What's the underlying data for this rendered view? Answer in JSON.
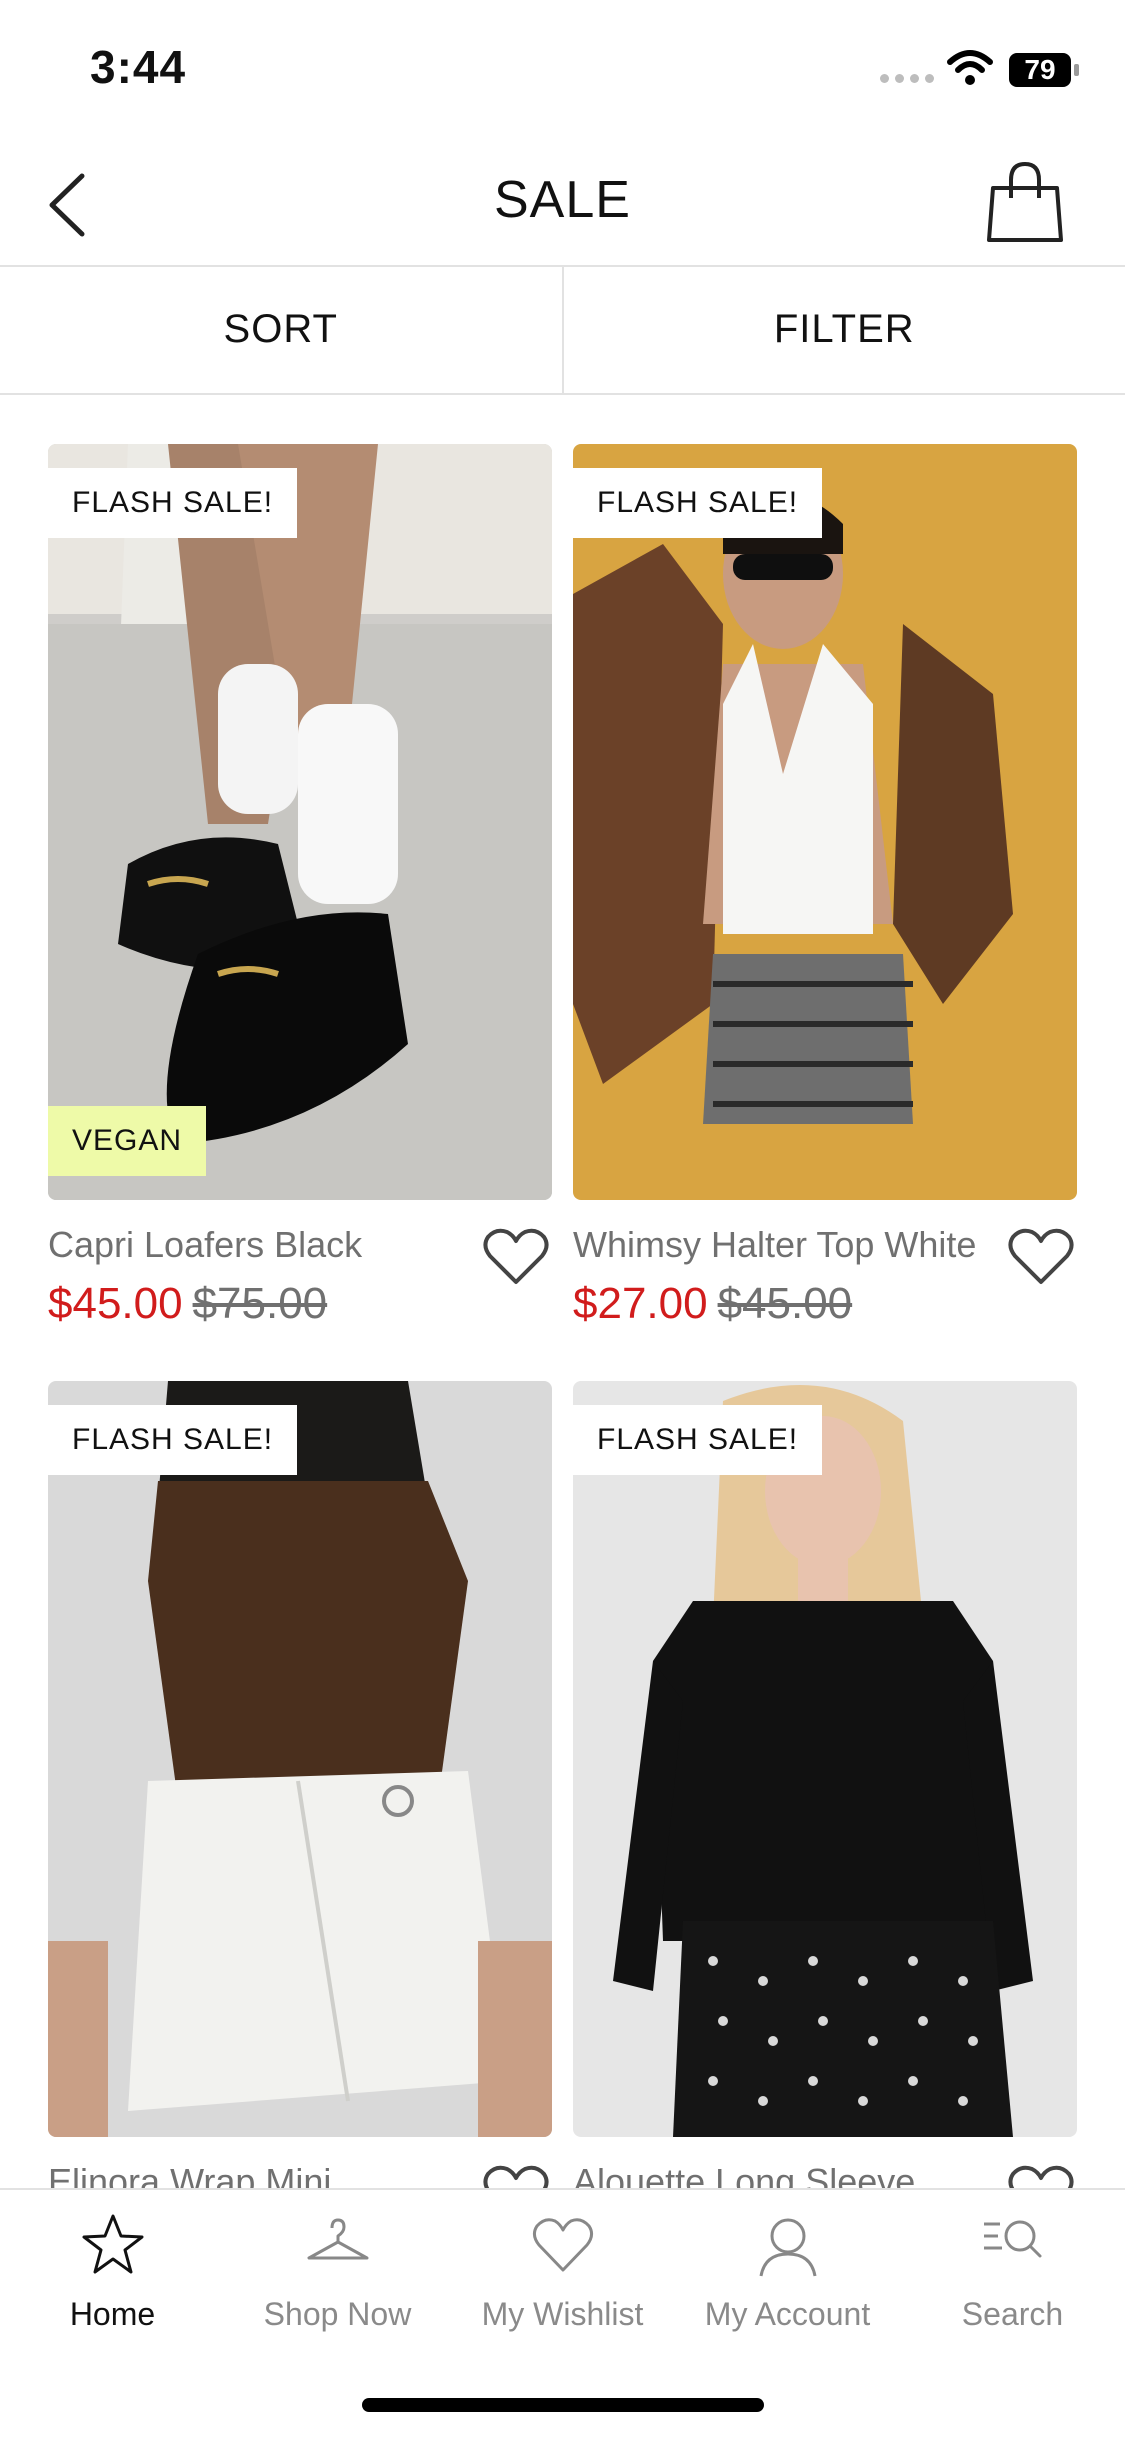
{
  "status": {
    "time": "3:44",
    "battery": "79"
  },
  "header": {
    "title": "SALE",
    "back_icon": "chevron-left-icon",
    "bag_icon": "shopping-bag-icon"
  },
  "toolbar": {
    "sort_label": "SORT",
    "filter_label": "FILTER"
  },
  "products": [
    {
      "badge": "FLASH SALE!",
      "extra_badge": "VEGAN",
      "name": "Capri Loafers Black",
      "price": "$45.00",
      "original_price": "$75.00"
    },
    {
      "badge": "FLASH SALE!",
      "name": "Whimsy Halter Top White",
      "price": "$27.00",
      "original_price": "$45.00"
    },
    {
      "badge": "FLASH SALE!",
      "name": "Elinora Wrap Mini"
    },
    {
      "badge": "FLASH SALE!",
      "name": "Alouette Long Sleeve"
    }
  ],
  "tabbar": {
    "items": [
      {
        "label": "Home",
        "icon": "star-icon",
        "active": true
      },
      {
        "label": "Shop Now",
        "icon": "hanger-icon",
        "active": false
      },
      {
        "label": "My Wishlist",
        "icon": "heart-icon",
        "active": false
      },
      {
        "label": "My Account",
        "icon": "person-icon",
        "active": false
      },
      {
        "label": "Search",
        "icon": "search-list-icon",
        "active": false
      }
    ]
  },
  "colors": {
    "sale_price": "#d11c1c",
    "vegan_badge": "#eefaa8",
    "muted_text": "#707070"
  }
}
